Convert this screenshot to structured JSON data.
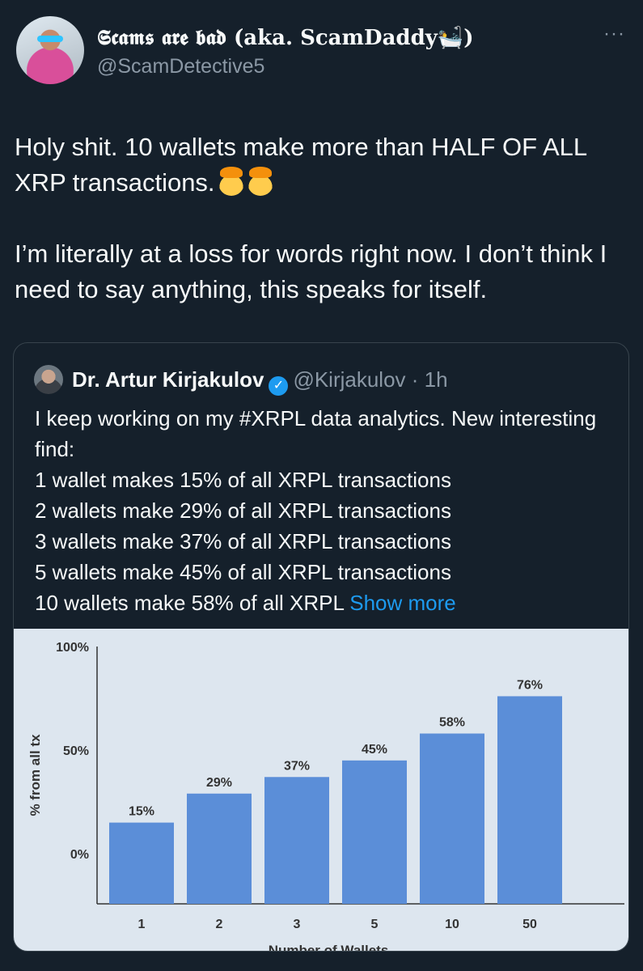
{
  "author": {
    "display_name": "𝕾𝖈𝖆𝖒𝖘 𝖆𝖗𝖊 𝖇𝖆𝖉 (aka. ScamDaddy🛀)",
    "handle": "@ScamDetective5",
    "avatar_icon": "avatar"
  },
  "more_icon": "···",
  "tweet": {
    "line1": "Holy shit. 10 wallets make more than HALF OF ALL XRP transactions.",
    "line2": "I’m literally at a loss for words right now. I don’t think I need to say anything, this speaks for itself."
  },
  "quote": {
    "name": "Dr. Artur Kirjakulov",
    "verified_icon": "verified-badge-icon",
    "handle": "@Kirjakulov",
    "dot": " · ",
    "time": "1h",
    "lines": [
      "I keep working on my #XRPL data analytics. New interesting find:",
      "1 wallet makes 15% of all XRPL transactions",
      "2 wallets make 29% of all XRPL transactions",
      "3 wallets make 37% of all XRPL transactions",
      "5 wallets make 45% of all XRPL transactions",
      "10 wallets make 58% of all XRPL"
    ],
    "show_more": "Show more"
  },
  "colors": {
    "background": "#15202b",
    "bar": "#5b8ed8",
    "chart_bg": "#dde6ef",
    "link": "#1d9bf0"
  },
  "chart_data": {
    "type": "bar",
    "categories": [
      "1",
      "2",
      "3",
      "5",
      "10",
      "50"
    ],
    "values": [
      15,
      29,
      37,
      45,
      58,
      76
    ],
    "value_labels": [
      "15%",
      "29%",
      "37%",
      "45%",
      "58%",
      "76%"
    ],
    "ylabel": "% from all tx",
    "xlabel": "Number of Wallets",
    "ytick_labels": [
      "0%",
      "50%",
      "100%"
    ],
    "grid": false,
    "legend": "none"
  }
}
